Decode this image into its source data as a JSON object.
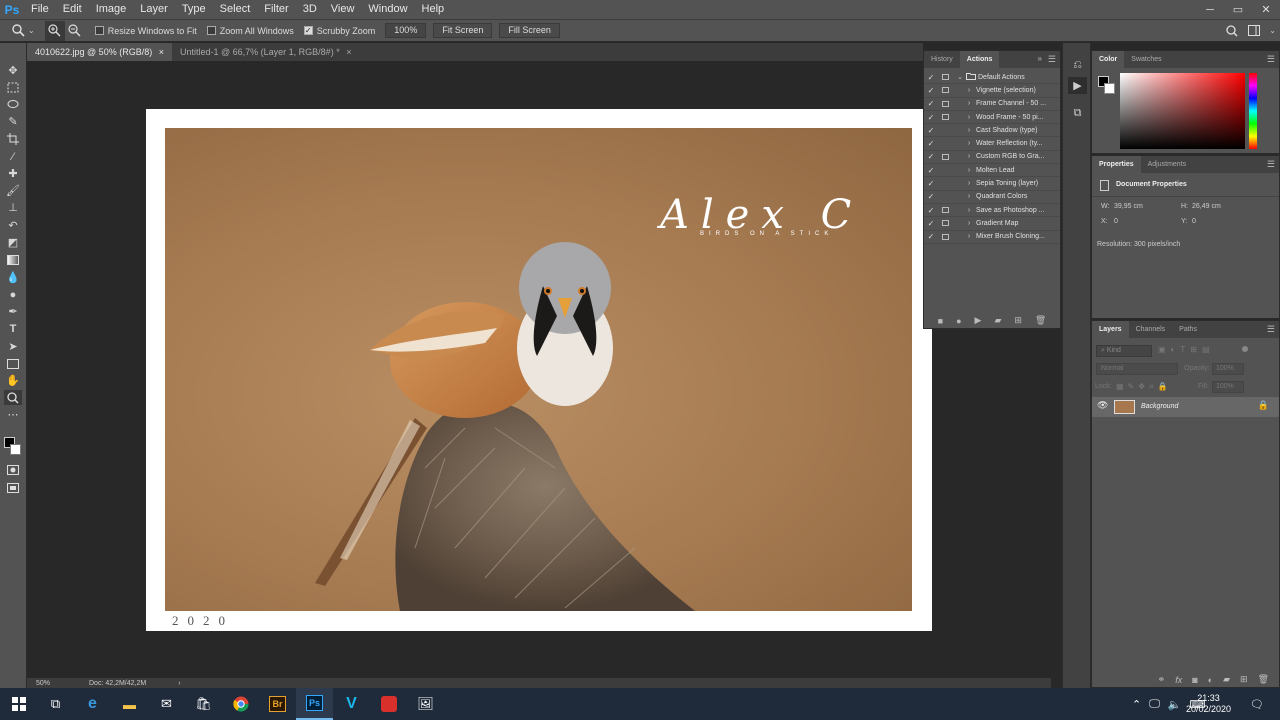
{
  "app": {
    "logo": "Ps"
  },
  "menubar": {
    "items": [
      "File",
      "Edit",
      "Image",
      "Layer",
      "Type",
      "Select",
      "Filter",
      "3D",
      "View",
      "Window",
      "Help"
    ],
    "window_controls": [
      "minimize",
      "maximize",
      "close"
    ]
  },
  "optionsbar": {
    "tool_icon": "zoom-icon",
    "resize_windows": "Resize Windows to Fit",
    "zoom_all": "Zoom All Windows",
    "scrubby": "Scrubby Zoom",
    "zoom_value": "100%",
    "fit_screen": "Fit Screen",
    "fill_screen": "Fill Screen"
  },
  "tabs": [
    {
      "label": "4010622.jpg @ 50% (RGB/8)",
      "close": "×",
      "active": true
    },
    {
      "label": "Untitled-1 @ 66,7% (Layer 1, RGB/8#) *",
      "close": "×",
      "active": false
    }
  ],
  "toolbar": {
    "tools": [
      "move",
      "marquee",
      "lasso",
      "quick-selection",
      "crop",
      "eyedropper",
      "healing-brush",
      "brush",
      "clone-stamp",
      "history-brush",
      "eraser",
      "gradient",
      "blur",
      "dodge",
      "pen",
      "type",
      "path-selection",
      "rectangle",
      "hand",
      "zoom",
      "more"
    ]
  },
  "canvas": {
    "signature": "Alex C",
    "signature_sub": "BIRDS ON A STICK",
    "year": "2020"
  },
  "status": {
    "zoom": "50%",
    "doc": "Doc: 42,2M/42,2M",
    "arrow": "›"
  },
  "actions_panel": {
    "tabs": [
      "History",
      "Actions"
    ],
    "active_tab": "Actions",
    "set_name": "Default Actions",
    "items": [
      {
        "label": "Vignette (selection)",
        "dialog": true
      },
      {
        "label": "Frame Channel - 50 ...",
        "dialog": true
      },
      {
        "label": "Wood Frame - 50 pi...",
        "dialog": true
      },
      {
        "label": "Cast Shadow (type)",
        "dialog": false
      },
      {
        "label": "Water Reflection (ty...",
        "dialog": false
      },
      {
        "label": "Custom RGB to Gra...",
        "dialog": true
      },
      {
        "label": "Molten Lead",
        "dialog": false
      },
      {
        "label": "Sepia Toning (layer)",
        "dialog": false
      },
      {
        "label": "Quadrant Colors",
        "dialog": false
      },
      {
        "label": "Save as Photoshop ...",
        "dialog": true
      },
      {
        "label": "Gradient Map",
        "dialog": true
      },
      {
        "label": "Mixer Brush Cloning...",
        "dialog": true
      }
    ]
  },
  "color_panel": {
    "tabs": [
      "Color",
      "Swatches"
    ],
    "active_tab": "Color",
    "hue_color": "#ff0000"
  },
  "properties_panel": {
    "tabs": [
      "Properties",
      "Adjustments"
    ],
    "active_tab": "Properties",
    "title": "Document Properties",
    "w_label": "W:",
    "w_value": "39,95 cm",
    "h_label": "H:",
    "h_value": "26,49 cm",
    "x_label": "X:",
    "x_value": "0",
    "y_label": "Y:",
    "y_value": "0",
    "resolution": "Resolution: 300 pixels/inch"
  },
  "layers_panel": {
    "tabs": [
      "Layers",
      "Channels",
      "Paths"
    ],
    "active_tab": "Layers",
    "kind_placeholder": "Kind",
    "blend_mode": "Normal",
    "opacity_label": "Opacity:",
    "opacity_value": "100%",
    "lock_label": "Lock:",
    "fill_label": "Fill:",
    "fill_value": "100%",
    "layer_name": "Background"
  },
  "taskbar": {
    "time": "21:33",
    "date": "20/02/2020",
    "apps": [
      "start",
      "task-view",
      "edge",
      "file-explorer",
      "mail",
      "store",
      "chrome",
      "bridge",
      "photoshop",
      "vimeo",
      "photo-app",
      "photos"
    ]
  }
}
